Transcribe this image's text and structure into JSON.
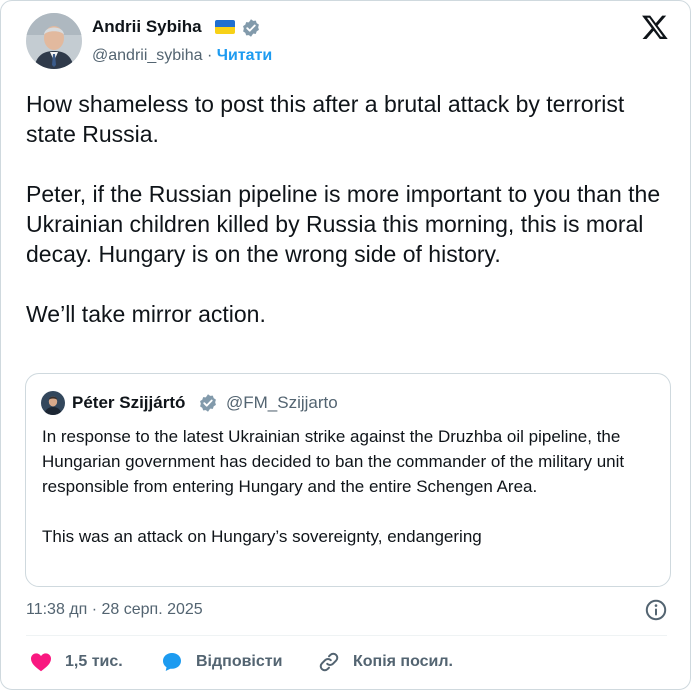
{
  "tweet": {
    "author": {
      "name": "Andrii Sybiha",
      "handle": "@andrii_sybiha",
      "separator": " · ",
      "follow_label": "Читати"
    },
    "paragraphs": [
      "How shameless to post this after a brutal attack by terrorist state Russia.",
      "Peter, if the Russian pipeline is more important to you than the Ukrainian children killed by Russia this morning, this is moral decay. Hungary is on the wrong side of history.",
      "We’ll take mirror action."
    ],
    "quote": {
      "name": "Péter Szijjártó",
      "handle": "@FM_Szijjarto",
      "paragraphs": [
        "In response to the latest Ukrainian strike against the Druzhba oil pipeline, the Hungarian government has decided to ban the commander of the military unit responsible from entering Hungary and the entire Schengen Area.",
        "This was an attack on Hungary’s sovereignty, endangering"
      ]
    },
    "timestamp": "11:38 дп · 28 серп. 2025",
    "actions": {
      "like_count": "1,5 тис.",
      "reply_label": "Відповісти",
      "copy_label": "Копія посил."
    }
  },
  "colors": {
    "text": "#0f1419",
    "secondary": "#536471",
    "accent": "#1d9bf0",
    "like": "#f91880",
    "border": "#cfd9de"
  },
  "icons": [
    "ukraine-flag-icon",
    "verified-badge-icon",
    "x-logo-icon",
    "info-icon",
    "heart-icon",
    "reply-bubble-icon",
    "link-icon"
  ]
}
